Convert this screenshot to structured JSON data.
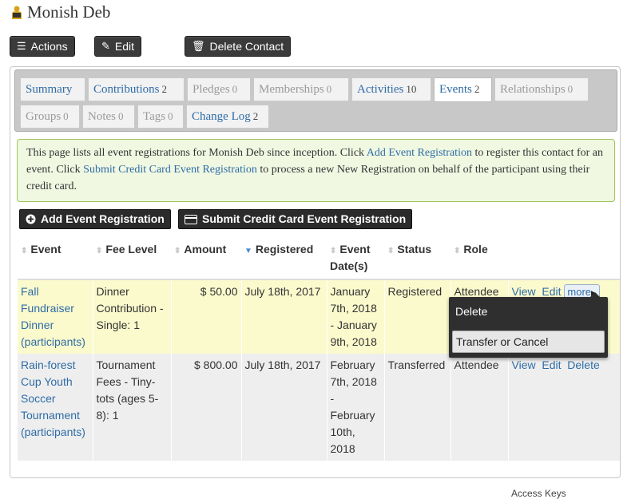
{
  "contact": {
    "name": "Monish Deb"
  },
  "actions": {
    "actions_label": "Actions",
    "edit_label": "Edit",
    "delete_label": "Delete Contact"
  },
  "tabs": [
    {
      "label": "Summary",
      "count": ""
    },
    {
      "label": "Contributions",
      "count": "2"
    },
    {
      "label": "Pledges",
      "count": "0"
    },
    {
      "label": "Memberships",
      "count": "0"
    },
    {
      "label": "Activities",
      "count": "10"
    },
    {
      "label": "Events",
      "count": "2"
    },
    {
      "label": "Relationships",
      "count": "0"
    },
    {
      "label": "Groups",
      "count": "0"
    },
    {
      "label": "Notes",
      "count": "0"
    },
    {
      "label": "Tags",
      "count": "0"
    },
    {
      "label": "Change Log",
      "count": "2"
    }
  ],
  "help": {
    "t1": "This page lists all event registrations for Monish Deb since inception. Click ",
    "link1": "Add Event Registration",
    "t2": " to register this contact for an event. Click ",
    "link2": "Submit Credit Card Event Registration",
    "t3": " to process a new New Registration on behalf of the participant using their credit card."
  },
  "buttons": {
    "add": "Add Event Registration",
    "submit_cc": "Submit Credit Card Event Registration"
  },
  "table": {
    "headers": [
      "Event",
      "Fee Level",
      "Amount",
      "Registered",
      "Event Date(s)",
      "Status",
      "Role"
    ],
    "rows": [
      {
        "event": "Fall Fundraiser Dinner (participants)",
        "fee": "Dinner Contribution - Single: 1",
        "amount": "$ 50.00",
        "registered": "July 18th, 2017",
        "dates": "January 7th, 2018 - January 9th, 2018",
        "status": "Registered",
        "role": "Attendee",
        "view": "View",
        "edit": "Edit",
        "more": "more"
      },
      {
        "event": "Rain-forest Cup Youth Soccer Tournament (participants)",
        "fee": "Tournament Fees - Tiny-tots (ages 5-8): 1",
        "amount": "$ 800.00",
        "registered": "July 18th, 2017",
        "dates": "February 7th, 2018 - February 10th, 2018",
        "status": "Transferred",
        "role": "Attendee",
        "view": "View",
        "edit": "Edit",
        "delete": "Delete"
      }
    ]
  },
  "more_menu": {
    "delete": "Delete",
    "transfer": "Transfer or Cancel"
  },
  "footer": {
    "hint": "Access Keys"
  }
}
